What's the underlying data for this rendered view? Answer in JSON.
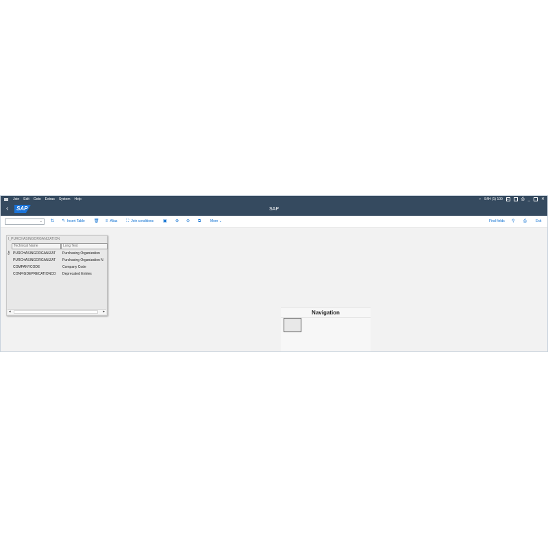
{
  "menubar": {
    "items": [
      "Join",
      "Edit",
      "Goto",
      "Extras",
      "System",
      "Help"
    ],
    "session": "S4H (1) 100"
  },
  "shellbar": {
    "logo": "SAP",
    "title": "SAP"
  },
  "toolbar": {
    "insert_table": "Insert Table",
    "alias": "Alias",
    "join_conditions": "Join conditions",
    "more": "More",
    "find_fields": "Find fields",
    "exit": "Exit"
  },
  "table": {
    "name": "I_PURCHASINGORGANIZATION",
    "columns": [
      "Technical Name",
      "Long Text"
    ],
    "rows": [
      {
        "tech": "PURCHASINGORGANIZAT",
        "text": "Purchasing Organization"
      },
      {
        "tech": "PURCHASINGORGANIZAT",
        "text": "Purchasing Organization N"
      },
      {
        "tech": "COMPANYCODE",
        "text": "Company Code"
      },
      {
        "tech": "CONFIGDEPRECATIONCO",
        "text": "Deprecated Entries"
      }
    ]
  },
  "navigation": {
    "title": "Navigation"
  }
}
